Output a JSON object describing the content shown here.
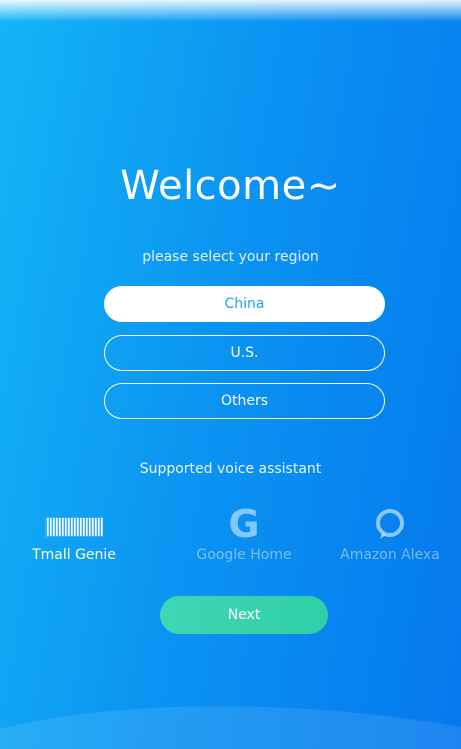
{
  "welcome": {
    "title": "Welcome~",
    "prompt": "please select your region"
  },
  "regions": [
    {
      "label": "China",
      "selected": true
    },
    {
      "label": "U.S.",
      "selected": false
    },
    {
      "label": "Others",
      "selected": false
    }
  ],
  "voice_assistants": {
    "heading": "Supported voice assistant",
    "items": [
      {
        "name": "Tmall Genie",
        "icon": "tmall-genie-icon",
        "active": true
      },
      {
        "name": "Google Home",
        "icon": "google-g-icon",
        "active": false
      },
      {
        "name": "Amazon Alexa",
        "icon": "alexa-ring-icon",
        "active": false
      }
    ]
  },
  "actions": {
    "next_label": "Next"
  },
  "colors": {
    "gradient_start": "#14b4f5",
    "gradient_end": "#0578ee",
    "selected_text": "#1aa8f0",
    "next_button": "#3fd6b5"
  }
}
